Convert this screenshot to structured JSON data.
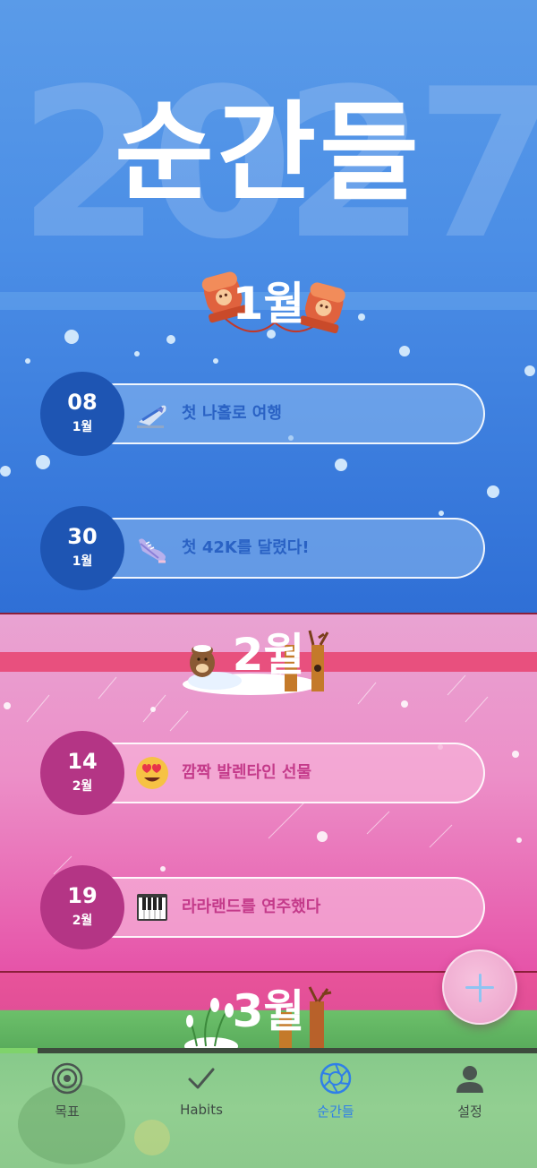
{
  "page": {
    "year": "2027",
    "title": "순간들"
  },
  "months": [
    {
      "label": "1월",
      "moments": [
        {
          "day": "08",
          "month": "1월",
          "icon": "bullet-train-icon",
          "text": "첫 나홀로 여행"
        },
        {
          "day": "30",
          "month": "1월",
          "icon": "running-shoe-icon",
          "text": "첫 42K를 달렸다!"
        }
      ]
    },
    {
      "label": "2월",
      "moments": [
        {
          "day": "14",
          "month": "2월",
          "icon": "heart-eyes-emoji-icon",
          "text": "깜짝 발렌타인 선물"
        },
        {
          "day": "19",
          "month": "2월",
          "icon": "piano-keys-icon",
          "text": "라라랜드를 연주했다"
        }
      ]
    },
    {
      "label": "3월",
      "moments": []
    }
  ],
  "fab": {
    "icon": "plus-icon"
  },
  "year_progress": 0.07,
  "tabs": [
    {
      "label": "목표",
      "icon": "target-icon",
      "active": false
    },
    {
      "label": "Habits",
      "icon": "checkmark-icon",
      "active": false
    },
    {
      "label": "순간들",
      "icon": "aperture-icon",
      "active": true
    },
    {
      "label": "설정",
      "icon": "person-icon",
      "active": false
    }
  ],
  "colors": {
    "jan_background": "#4b8ee6",
    "feb_background": "#ec8fc8",
    "mar_background": "#6cc06a",
    "jan_badge": "#1e55b3",
    "feb_badge": "#b43585",
    "active_tab": "#2f7fe8",
    "divider": "#8b1f3a"
  }
}
